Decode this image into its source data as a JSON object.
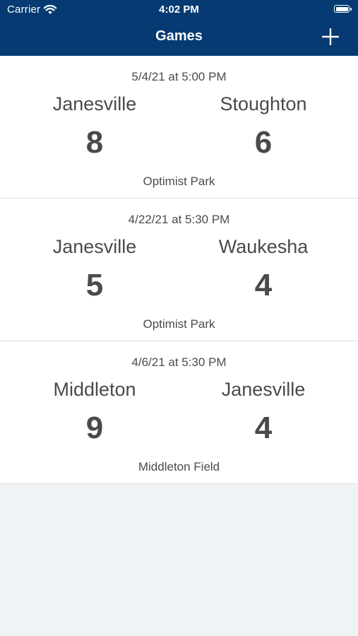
{
  "status": {
    "carrier": "Carrier",
    "time": "4:02 PM"
  },
  "nav": {
    "title": "Games"
  },
  "games": [
    {
      "date": "5/4/21 at 5:00 PM",
      "home_team": "Janesville",
      "away_team": "Stoughton",
      "home_score": "8",
      "away_score": "6",
      "location": "Optimist Park"
    },
    {
      "date": "4/22/21 at 5:30 PM",
      "home_team": "Janesville",
      "away_team": "Waukesha",
      "home_score": "5",
      "away_score": "4",
      "location": "Optimist Park"
    },
    {
      "date": "4/6/21 at 5:30 PM",
      "home_team": "Middleton",
      "away_team": "Janesville",
      "home_score": "9",
      "away_score": "4",
      "location": "Middleton Field"
    }
  ],
  "colors": {
    "header": "#053b72",
    "background": "#eff3f6",
    "text": "#4a4a4a"
  }
}
